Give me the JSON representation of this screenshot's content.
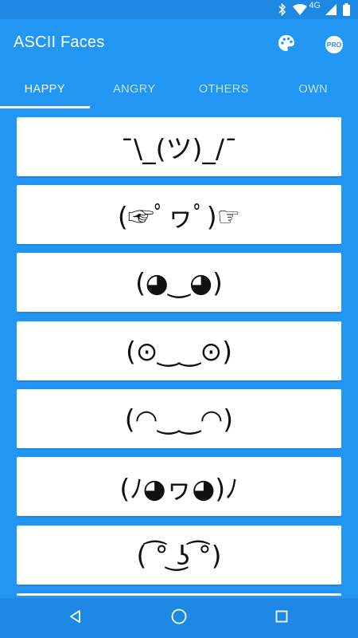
{
  "status_bar": {
    "network_label": "4G",
    "icons": [
      "bluetooth-icon",
      "wifi-icon",
      "cell-signal-icon",
      "battery-icon"
    ]
  },
  "app_bar": {
    "title": "ASCII Faces",
    "actions": [
      "palette-icon",
      "pro-badge"
    ],
    "pro_label": "PRO"
  },
  "tabs": [
    {
      "label": "HAPPY",
      "active": true
    },
    {
      "label": "ANGRY",
      "active": false
    },
    {
      "label": "OTHERS",
      "active": false
    },
    {
      "label": "OWN",
      "active": false
    }
  ],
  "faces": [
    "¯\\_(ツ)_/¯",
    "(☞ﾟヮﾟ)☞",
    "(◕‿◕)",
    "(⊙‿‿⊙)",
    "(◠‿‿◠)",
    "(ﾉ◕ヮ◕)ﾉ",
    "( ͡° ͜ʖ ͡°)"
  ],
  "nav_bar": {
    "icons": [
      "back-icon",
      "home-icon",
      "recents-icon"
    ]
  },
  "colors": {
    "primary": "#2196f3",
    "primary_dark": "#1e88e5",
    "card": "#ffffff",
    "text_on_primary": "#ffffff"
  }
}
